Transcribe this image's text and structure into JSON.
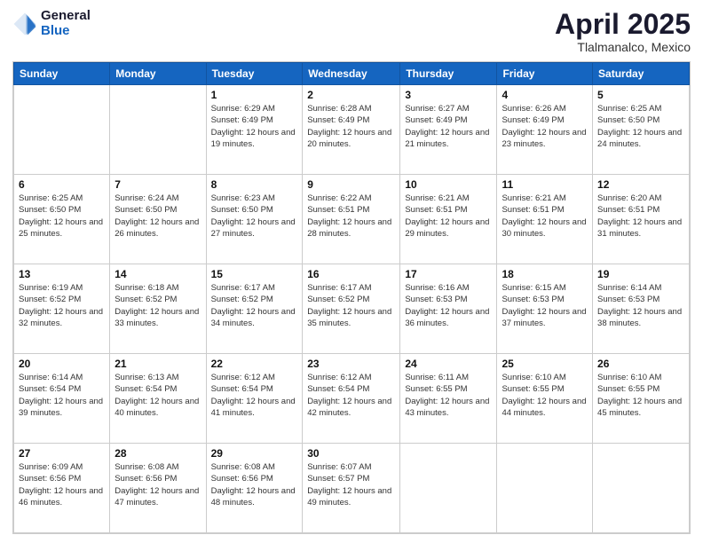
{
  "logo": {
    "general": "General",
    "blue": "Blue"
  },
  "header": {
    "title": "April 2025",
    "location": "Tlalmanalco, Mexico"
  },
  "weekdays": [
    "Sunday",
    "Monday",
    "Tuesday",
    "Wednesday",
    "Thursday",
    "Friday",
    "Saturday"
  ],
  "weeks": [
    [
      {
        "day": "",
        "sunrise": "",
        "sunset": "",
        "daylight": ""
      },
      {
        "day": "",
        "sunrise": "",
        "sunset": "",
        "daylight": ""
      },
      {
        "day": "1",
        "sunrise": "Sunrise: 6:29 AM",
        "sunset": "Sunset: 6:49 PM",
        "daylight": "Daylight: 12 hours and 19 minutes."
      },
      {
        "day": "2",
        "sunrise": "Sunrise: 6:28 AM",
        "sunset": "Sunset: 6:49 PM",
        "daylight": "Daylight: 12 hours and 20 minutes."
      },
      {
        "day": "3",
        "sunrise": "Sunrise: 6:27 AM",
        "sunset": "Sunset: 6:49 PM",
        "daylight": "Daylight: 12 hours and 21 minutes."
      },
      {
        "day": "4",
        "sunrise": "Sunrise: 6:26 AM",
        "sunset": "Sunset: 6:49 PM",
        "daylight": "Daylight: 12 hours and 23 minutes."
      },
      {
        "day": "5",
        "sunrise": "Sunrise: 6:25 AM",
        "sunset": "Sunset: 6:50 PM",
        "daylight": "Daylight: 12 hours and 24 minutes."
      }
    ],
    [
      {
        "day": "6",
        "sunrise": "Sunrise: 6:25 AM",
        "sunset": "Sunset: 6:50 PM",
        "daylight": "Daylight: 12 hours and 25 minutes."
      },
      {
        "day": "7",
        "sunrise": "Sunrise: 6:24 AM",
        "sunset": "Sunset: 6:50 PM",
        "daylight": "Daylight: 12 hours and 26 minutes."
      },
      {
        "day": "8",
        "sunrise": "Sunrise: 6:23 AM",
        "sunset": "Sunset: 6:50 PM",
        "daylight": "Daylight: 12 hours and 27 minutes."
      },
      {
        "day": "9",
        "sunrise": "Sunrise: 6:22 AM",
        "sunset": "Sunset: 6:51 PM",
        "daylight": "Daylight: 12 hours and 28 minutes."
      },
      {
        "day": "10",
        "sunrise": "Sunrise: 6:21 AM",
        "sunset": "Sunset: 6:51 PM",
        "daylight": "Daylight: 12 hours and 29 minutes."
      },
      {
        "day": "11",
        "sunrise": "Sunrise: 6:21 AM",
        "sunset": "Sunset: 6:51 PM",
        "daylight": "Daylight: 12 hours and 30 minutes."
      },
      {
        "day": "12",
        "sunrise": "Sunrise: 6:20 AM",
        "sunset": "Sunset: 6:51 PM",
        "daylight": "Daylight: 12 hours and 31 minutes."
      }
    ],
    [
      {
        "day": "13",
        "sunrise": "Sunrise: 6:19 AM",
        "sunset": "Sunset: 6:52 PM",
        "daylight": "Daylight: 12 hours and 32 minutes."
      },
      {
        "day": "14",
        "sunrise": "Sunrise: 6:18 AM",
        "sunset": "Sunset: 6:52 PM",
        "daylight": "Daylight: 12 hours and 33 minutes."
      },
      {
        "day": "15",
        "sunrise": "Sunrise: 6:17 AM",
        "sunset": "Sunset: 6:52 PM",
        "daylight": "Daylight: 12 hours and 34 minutes."
      },
      {
        "day": "16",
        "sunrise": "Sunrise: 6:17 AM",
        "sunset": "Sunset: 6:52 PM",
        "daylight": "Daylight: 12 hours and 35 minutes."
      },
      {
        "day": "17",
        "sunrise": "Sunrise: 6:16 AM",
        "sunset": "Sunset: 6:53 PM",
        "daylight": "Daylight: 12 hours and 36 minutes."
      },
      {
        "day": "18",
        "sunrise": "Sunrise: 6:15 AM",
        "sunset": "Sunset: 6:53 PM",
        "daylight": "Daylight: 12 hours and 37 minutes."
      },
      {
        "day": "19",
        "sunrise": "Sunrise: 6:14 AM",
        "sunset": "Sunset: 6:53 PM",
        "daylight": "Daylight: 12 hours and 38 minutes."
      }
    ],
    [
      {
        "day": "20",
        "sunrise": "Sunrise: 6:14 AM",
        "sunset": "Sunset: 6:54 PM",
        "daylight": "Daylight: 12 hours and 39 minutes."
      },
      {
        "day": "21",
        "sunrise": "Sunrise: 6:13 AM",
        "sunset": "Sunset: 6:54 PM",
        "daylight": "Daylight: 12 hours and 40 minutes."
      },
      {
        "day": "22",
        "sunrise": "Sunrise: 6:12 AM",
        "sunset": "Sunset: 6:54 PM",
        "daylight": "Daylight: 12 hours and 41 minutes."
      },
      {
        "day": "23",
        "sunrise": "Sunrise: 6:12 AM",
        "sunset": "Sunset: 6:54 PM",
        "daylight": "Daylight: 12 hours and 42 minutes."
      },
      {
        "day": "24",
        "sunrise": "Sunrise: 6:11 AM",
        "sunset": "Sunset: 6:55 PM",
        "daylight": "Daylight: 12 hours and 43 minutes."
      },
      {
        "day": "25",
        "sunrise": "Sunrise: 6:10 AM",
        "sunset": "Sunset: 6:55 PM",
        "daylight": "Daylight: 12 hours and 44 minutes."
      },
      {
        "day": "26",
        "sunrise": "Sunrise: 6:10 AM",
        "sunset": "Sunset: 6:55 PM",
        "daylight": "Daylight: 12 hours and 45 minutes."
      }
    ],
    [
      {
        "day": "27",
        "sunrise": "Sunrise: 6:09 AM",
        "sunset": "Sunset: 6:56 PM",
        "daylight": "Daylight: 12 hours and 46 minutes."
      },
      {
        "day": "28",
        "sunrise": "Sunrise: 6:08 AM",
        "sunset": "Sunset: 6:56 PM",
        "daylight": "Daylight: 12 hours and 47 minutes."
      },
      {
        "day": "29",
        "sunrise": "Sunrise: 6:08 AM",
        "sunset": "Sunset: 6:56 PM",
        "daylight": "Daylight: 12 hours and 48 minutes."
      },
      {
        "day": "30",
        "sunrise": "Sunrise: 6:07 AM",
        "sunset": "Sunset: 6:57 PM",
        "daylight": "Daylight: 12 hours and 49 minutes."
      },
      {
        "day": "",
        "sunrise": "",
        "sunset": "",
        "daylight": ""
      },
      {
        "day": "",
        "sunrise": "",
        "sunset": "",
        "daylight": ""
      },
      {
        "day": "",
        "sunrise": "",
        "sunset": "",
        "daylight": ""
      }
    ]
  ]
}
